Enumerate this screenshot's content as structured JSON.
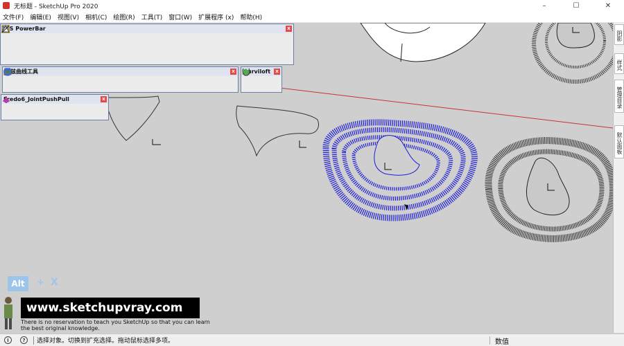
{
  "window": {
    "title": "无标题 - SketchUp Pro 2020",
    "minimize_glyph": "–",
    "maximize_glyph": "☐",
    "close_glyph": "✕"
  },
  "menu": [
    "文件(F)",
    "编辑(E)",
    "视图(V)",
    "相机(C)",
    "绘图(R)",
    "工具(T)",
    "窗口(W)",
    "扩展程序 (x)",
    "帮助(H)"
  ],
  "right_panel": {
    "tabs": [
      "阴影",
      "样式",
      "管理目录",
      "默认面板"
    ]
  },
  "toolbars": {
    "jhs": {
      "title": "JHS PowerBar",
      "close": "x"
    },
    "bezier": {
      "title": "贝兹曲线工具",
      "close": "x"
    },
    "curviloft": {
      "title": "Curviloft",
      "close": "x"
    },
    "fredo": {
      "title": "Fredo6_JointPushPull",
      "close": "x"
    }
  },
  "shortcut_overlay": {
    "key": "Alt",
    "plus": "+",
    "x": "X"
  },
  "watermark": {
    "banner": "www.sketchupvray.com",
    "line1": "There is no reservation to teach you SketchUp so that you can learn",
    "line2": "the best original knowledge."
  },
  "status": {
    "info_icon": "i",
    "help_icon": "?",
    "message": "选择对象。切换到扩充选择。拖动鼠标选择多项。",
    "value_label": "数值",
    "value": ""
  },
  "colors": {
    "lofted_surface": "#1c1cd8",
    "red_axis": "#c83232",
    "background": "#cfcfcf"
  }
}
